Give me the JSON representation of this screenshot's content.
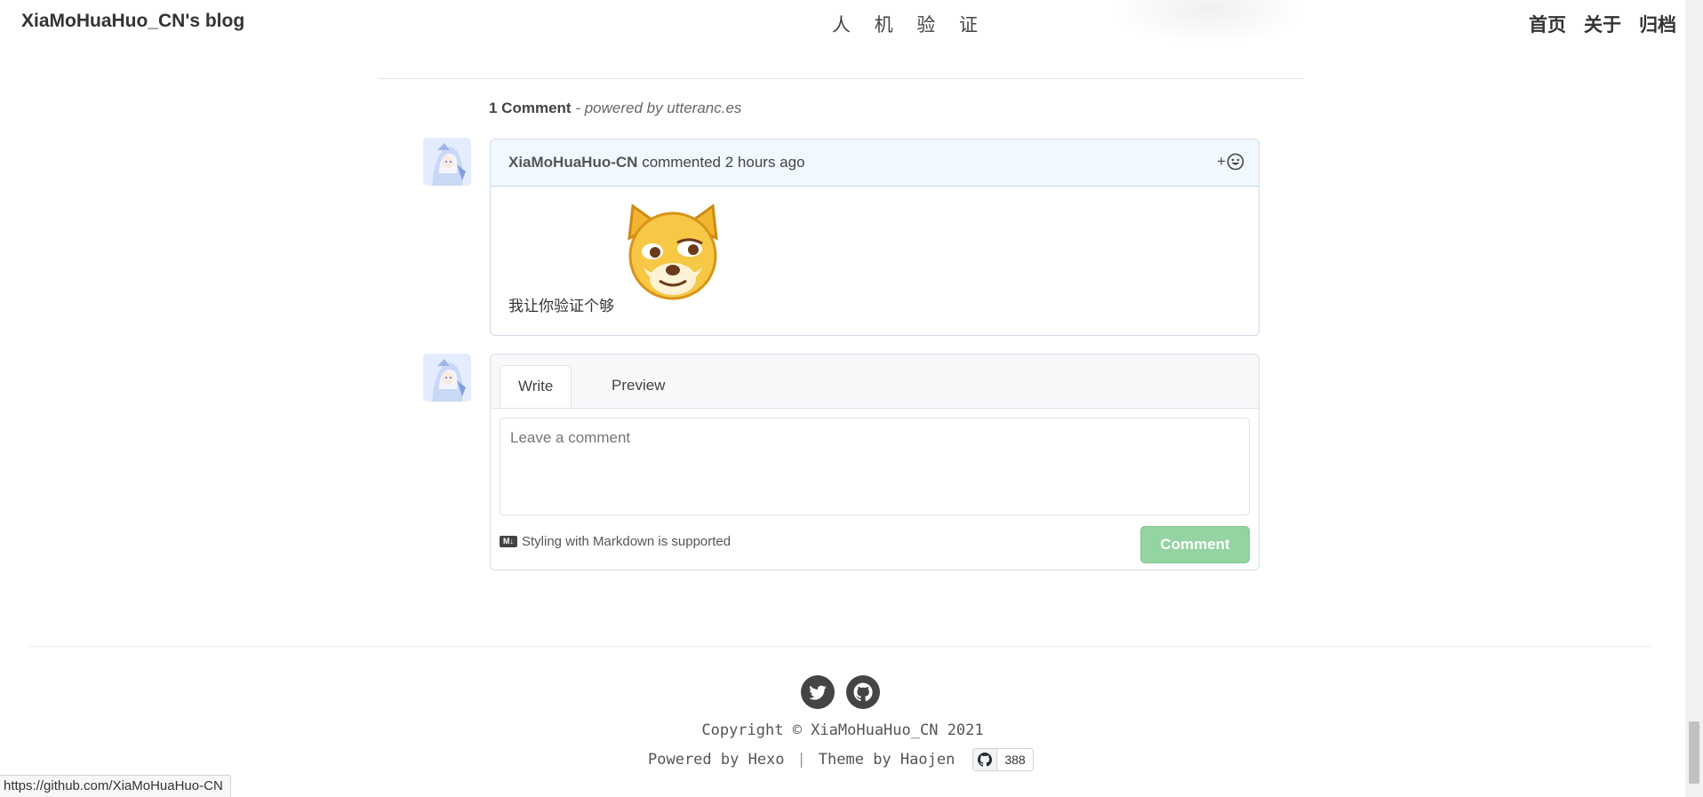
{
  "header": {
    "brand": "XiaMoHuaHuo_CN's blog",
    "page_title": "人 机 验 证",
    "nav": [
      {
        "label": "首页"
      },
      {
        "label": "关于"
      },
      {
        "label": "归档"
      }
    ]
  },
  "comments": {
    "count_label": "1 Comment",
    "powered_label": "- powered by utteranc.es",
    "items": [
      {
        "author": "XiaMoHuaHuo-CN",
        "action": "commented",
        "time": "2 hours ago",
        "reaction_label": "+",
        "body": "我让你验证个够"
      }
    ]
  },
  "composer": {
    "tabs": [
      {
        "label": "Write"
      },
      {
        "label": "Preview"
      }
    ],
    "placeholder": "Leave a comment",
    "markdown_note": "Styling with Markdown is supported",
    "markdown_icon": "M↓",
    "submit_label": "Comment"
  },
  "footer": {
    "copyright": "Copyright © XiaMoHuaHuo_CN 2021",
    "powered_by": "Powered by Hexo",
    "theme_by": "Theme by Haojen",
    "separator": "|",
    "github_stars": "388",
    "icons": [
      "twitter-icon",
      "github-icon"
    ]
  },
  "status_bar": {
    "url": "https://github.com/XiaMoHuaHuo-CN"
  },
  "colors": {
    "comment_header_bg": "#f1f8ff",
    "comment_button": "#94d3a2",
    "text": "#333333"
  }
}
